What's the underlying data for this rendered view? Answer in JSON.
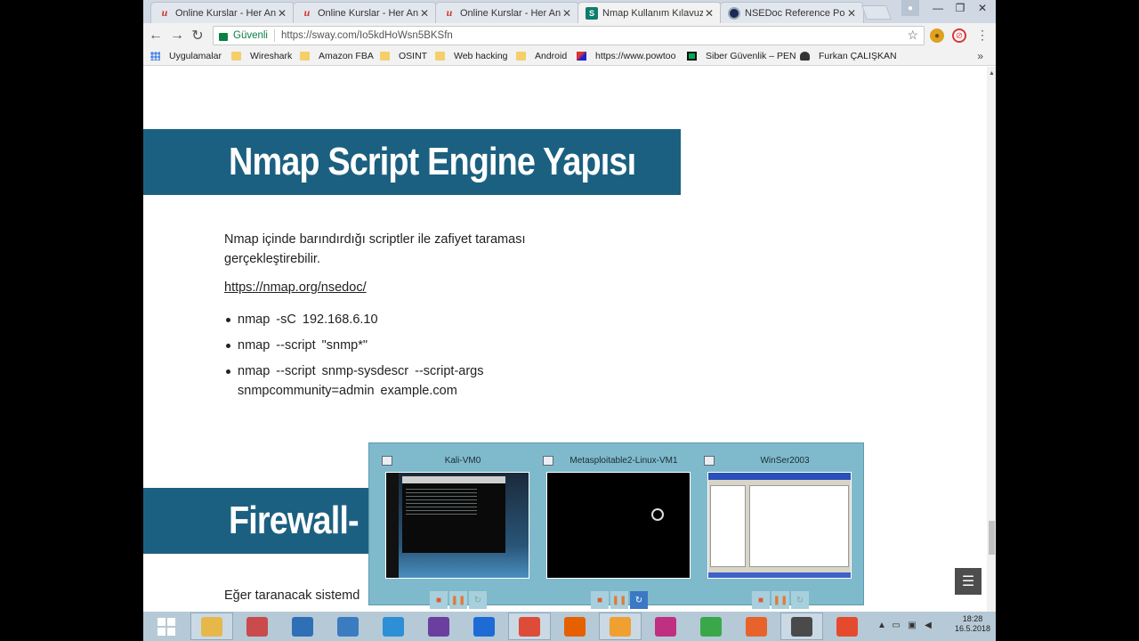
{
  "browser": {
    "tabs": [
      {
        "title": "Online Kurslar - Her An, ",
        "favicon": "udemy-icon",
        "active": false
      },
      {
        "title": "Online Kurslar - Her An, ",
        "favicon": "udemy-icon",
        "active": false
      },
      {
        "title": "Online Kurslar - Her An, ",
        "favicon": "udemy-icon",
        "active": false
      },
      {
        "title": "Nmap Kullanım Kılavuzu",
        "favicon": "sway-icon",
        "active": true
      },
      {
        "title": "NSEDoc Reference Portal",
        "favicon": "nse-icon",
        "active": false
      }
    ],
    "security_label": "Güvenli",
    "url": "https://sway.com/Io5kdHoWsn5BKSfn",
    "bookmarks": [
      {
        "label": "Uygulamalar",
        "icon": "apps-icon"
      },
      {
        "label": "Wireshark",
        "icon": "folder-icon"
      },
      {
        "label": "Amazon FBA",
        "icon": "folder-icon"
      },
      {
        "label": "OSINT",
        "icon": "folder-icon"
      },
      {
        "label": "Web hacking",
        "icon": "folder-icon"
      },
      {
        "label": "Android",
        "icon": "folder-icon"
      },
      {
        "label": "https://www.powtoo",
        "icon": "powtoon-icon"
      },
      {
        "label": "Siber Güvenlik – PEN",
        "icon": "cyber-icon"
      },
      {
        "label": "Furkan ÇALIŞKAN",
        "icon": "profile-icon"
      }
    ],
    "bookmarks_more": "»"
  },
  "page": {
    "heading1": "Nmap Script Engine Yapısı",
    "intro": "Nmap içinde barındırdığı scriptler ile zafiyet taraması gerçekleştirebilir.",
    "link": "https://nmap.org/nsedoc/",
    "commands": [
      "nmap -sC  192.168.6.10",
      "nmap --script  \"snmp*\"",
      "nmap  --script  snmp-sysdescr  --script-args  snmpcommunity=admin  example.com"
    ],
    "heading2": "Firewall-",
    "bottom_text": "Eğer taranacak sistemd"
  },
  "vm_panel": {
    "vms": [
      {
        "name": "Kali-VM0"
      },
      {
        "name": "Metasploitable2-Linux-VM1"
      },
      {
        "name": "WinSer2003"
      }
    ]
  },
  "taskbar": {
    "clock_time": "18:28",
    "clock_date": "16.5.2018",
    "apps": [
      {
        "name": "start-button",
        "icon": "windows-icon",
        "color": "#1f6fb8"
      },
      {
        "name": "file-explorer",
        "icon": "folder-icon",
        "color": "#e6b84a"
      },
      {
        "name": "snipping-tool",
        "icon": "scissors-icon",
        "color": "#c94b4b"
      },
      {
        "name": "wireshark",
        "icon": "fin-icon",
        "color": "#2f6fb5"
      },
      {
        "name": "search-app",
        "icon": "magnifier-icon",
        "color": "#3a7cc0"
      },
      {
        "name": "sourcetree",
        "icon": "tree-icon",
        "color": "#2d8fd5"
      },
      {
        "name": "visual-studio",
        "icon": "vs-icon",
        "color": "#6a3fa0"
      },
      {
        "name": "headset-app",
        "icon": "headset-icon",
        "color": "#1e6bd6"
      },
      {
        "name": "chrome",
        "icon": "chrome-icon",
        "color": "#dd4b39"
      },
      {
        "name": "firefox",
        "icon": "firefox-icon",
        "color": "#e66000"
      },
      {
        "name": "vm-manager",
        "icon": "vm-icon",
        "color": "#f0a030"
      },
      {
        "name": "molecule-app",
        "icon": "molecule-icon",
        "color": "#c03080"
      },
      {
        "name": "camtasia",
        "icon": "camtasia-icon",
        "color": "#3aa84a"
      },
      {
        "name": "burp-suite",
        "icon": "burp-icon",
        "color": "#e8632b"
      },
      {
        "name": "sublime-text",
        "icon": "sublime-icon",
        "color": "#4a4a4a"
      },
      {
        "name": "ccleaner",
        "icon": "ccleaner-icon",
        "color": "#e64a2e"
      }
    ]
  }
}
